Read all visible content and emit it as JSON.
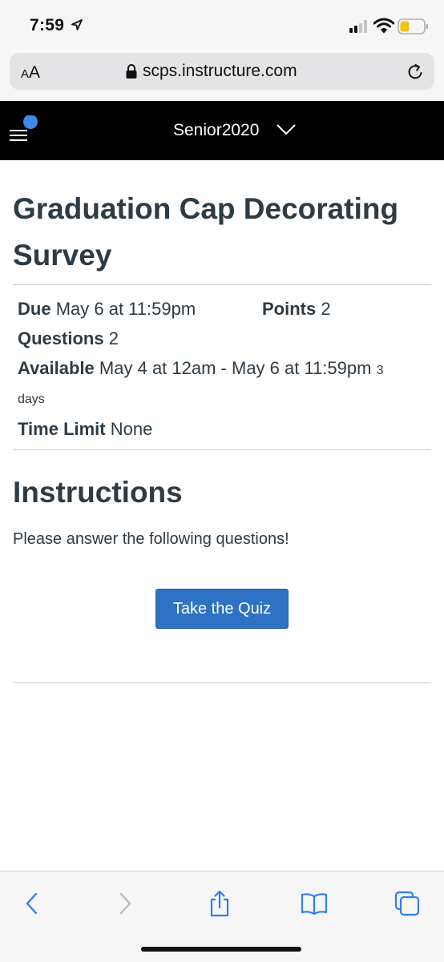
{
  "status_bar": {
    "time": "7:59"
  },
  "browser": {
    "text_size_label_small": "A",
    "text_size_label_large": "A",
    "url": "scps.instructure.com"
  },
  "header": {
    "course_name": "Senior2020"
  },
  "quiz": {
    "title": "Graduation Cap Decorating Survey",
    "due_label": "Due",
    "due_value": "May 6 at 11:59pm",
    "points_label": "Points",
    "points_value": "2",
    "questions_label": "Questions",
    "questions_value": "2",
    "available_label": "Available",
    "available_value": "May 4 at 12am - May 6 at 11:59pm",
    "available_duration_number": "3",
    "available_duration_unit": "days",
    "time_limit_label": "Time Limit",
    "time_limit_value": "None"
  },
  "instructions": {
    "heading": "Instructions",
    "text": "Please answer the following questions!"
  },
  "actions": {
    "take_quiz_label": "Take the Quiz"
  },
  "colors": {
    "header_bg": "#000000",
    "accent_blue": "#2d72c4",
    "text": "#2d3b45",
    "notification_dot": "#3e8ae6"
  }
}
